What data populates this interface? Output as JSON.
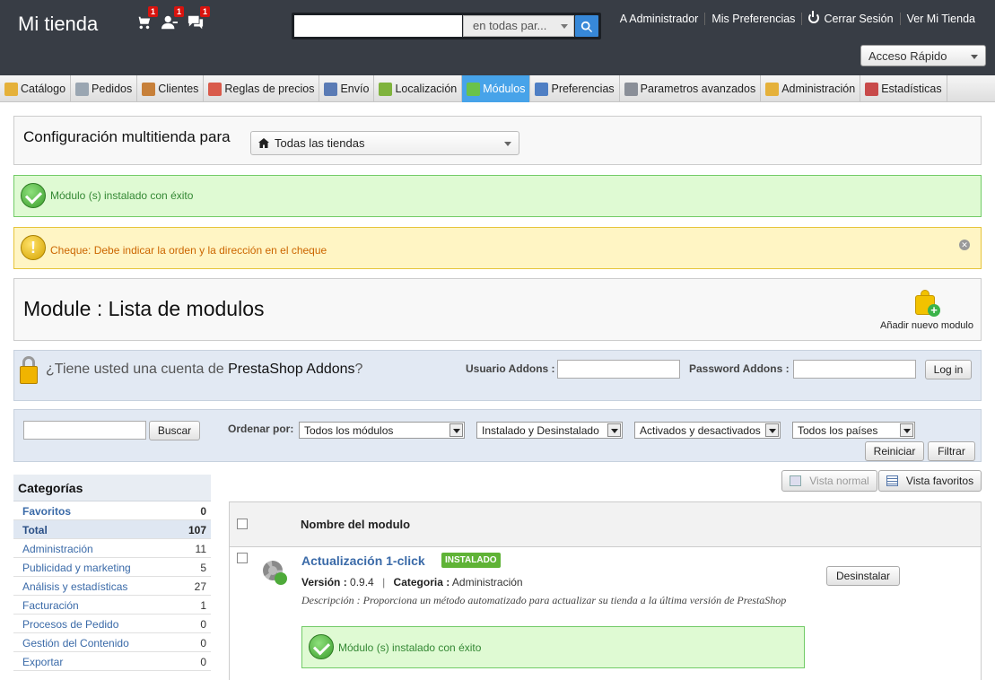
{
  "header": {
    "shop_name": "Mi tienda",
    "notifications": [
      {
        "icon": "cart-icon",
        "count": "1"
      },
      {
        "icon": "customer-icon",
        "count": "1"
      },
      {
        "icon": "messages-icon",
        "count": "1"
      }
    ],
    "search": {
      "value": "",
      "scope": "en todas par..."
    },
    "links": [
      "A Administrador",
      "Mis Preferencias",
      "Cerrar Sesión",
      "Ver Mi Tienda"
    ],
    "quick_access": "Acceso Rápido"
  },
  "menu": {
    "tabs": [
      {
        "label": "Catálogo",
        "icon": "folder-icon",
        "color": "#e5b13a"
      },
      {
        "label": "Pedidos",
        "icon": "cart-icon",
        "color": "#9aa6b2"
      },
      {
        "label": "Clientes",
        "icon": "user-icon",
        "color": "#c7803a"
      },
      {
        "label": "Reglas de precios",
        "icon": "price-rules-icon",
        "color": "#d95b4b"
      },
      {
        "label": "Envío",
        "icon": "truck-icon",
        "color": "#5a7bb5"
      },
      {
        "label": "Localización",
        "icon": "globe-icon",
        "color": "#7fb33d"
      },
      {
        "label": "Módulos",
        "icon": "puzzle-icon",
        "color": "#6ac24a",
        "active": true
      },
      {
        "label": "Preferencias",
        "icon": "preferences-icon",
        "color": "#4f7fc4"
      },
      {
        "label": "Parametros avanzados",
        "icon": "wrench-icon",
        "color": "#8a8f98"
      },
      {
        "label": "Administración",
        "icon": "key-icon",
        "color": "#e5b13a"
      },
      {
        "label": "Estadísticas",
        "icon": "chart-icon",
        "color": "#c84a4a"
      }
    ],
    "active_color": "#47a3e9"
  },
  "multistore": {
    "label": "Configuración multitienda para",
    "selected": "Todas las tiendas"
  },
  "alerts": {
    "success": "Módulo (s) instalado con éxito",
    "warning": "Cheque: Debe indicar la orden y la dirección en el cheque"
  },
  "page": {
    "title": "Module : Lista de modulos",
    "add_module": "Añadir nuevo modulo"
  },
  "addons": {
    "prefix": "¿Tiene usted una cuenta de ",
    "brand": "PrestaShop Addons",
    "suffix": "?",
    "user_label": "Usuario Addons :",
    "password_label": "Password Addons :",
    "login_button": "Log in"
  },
  "filters": {
    "search_button": "Buscar",
    "sort_label": "Ordenar por:",
    "selects": [
      "Todos los módulos",
      "Instalado y Desinstalado",
      "Activados y desactivados",
      "Todos los países"
    ],
    "reset_button": "Reiniciar",
    "filter_button": "Filtrar"
  },
  "categories": {
    "title": "Categorías",
    "items": [
      {
        "name": "Favoritos",
        "count": "0"
      },
      {
        "name": "Total",
        "count": "107"
      },
      {
        "name": "Administración",
        "count": "11"
      },
      {
        "name": "Publicidad y marketing",
        "count": "5"
      },
      {
        "name": "Análisis y estadísticas",
        "count": "27"
      },
      {
        "name": "Facturación",
        "count": "1"
      },
      {
        "name": "Procesos de Pedido",
        "count": "0"
      },
      {
        "name": "Gestión del Contenido",
        "count": "0"
      },
      {
        "name": "Exportar",
        "count": "0"
      }
    ]
  },
  "views": {
    "normal": "Vista normal",
    "favorites": "Vista favoritos"
  },
  "module_list": {
    "header": "Nombre del modulo",
    "modules": [
      {
        "name": "Actualización 1-click",
        "badge": "INSTALADO",
        "version_label": "Versión :",
        "version": "0.9.4",
        "category_label": "Categoria :",
        "category": "Administración",
        "description": "Descripción : Proporciona un método automatizado para actualizar su tienda a la última versión de PrestaShop",
        "confirmation": "Módulo (s) instalado con éxito",
        "action": "Desinstalar"
      }
    ]
  }
}
